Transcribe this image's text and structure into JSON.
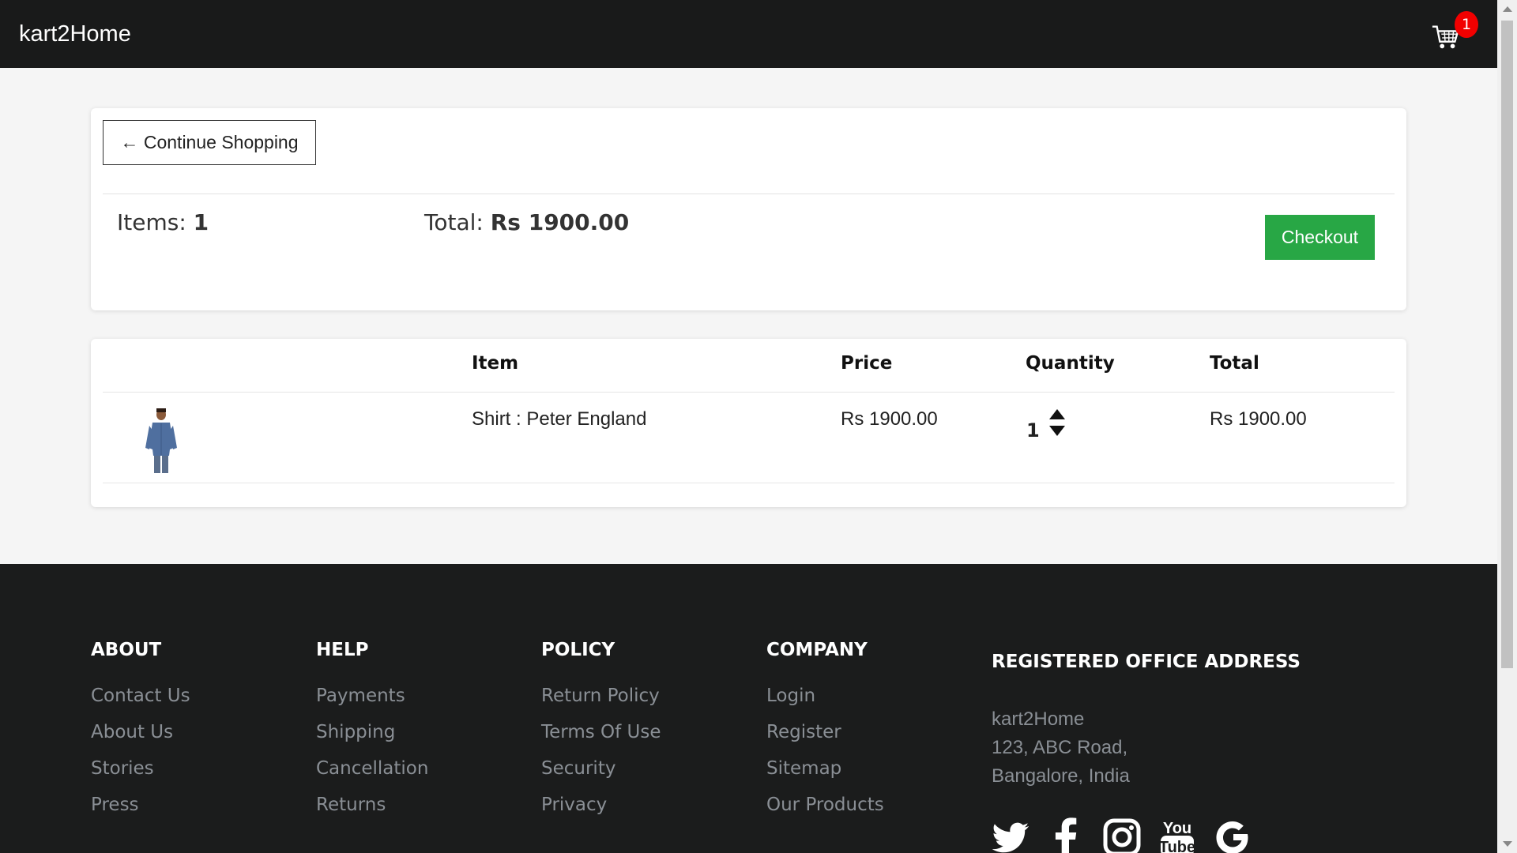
{
  "navbar": {
    "brand": "kart2Home",
    "cart_icon": "shopping-cart-icon",
    "cart_count": "1",
    "badge_color": "#f20000"
  },
  "summary": {
    "continue_label": "← Continue Shopping",
    "items_prefix": "Items:",
    "items_count": "1",
    "total_prefix": "Total:",
    "total_value": "Rs 1900.00",
    "checkout_label": "Checkout",
    "checkout_color": "#28a745"
  },
  "table": {
    "headers": [
      "Item",
      "Price",
      "Quantity",
      "Total"
    ],
    "rows": [
      {
        "thumbnail_icon": "shirt-product-image",
        "item": "Shirt : Peter England",
        "price": "Rs 1900.00",
        "quantity": "1",
        "total": "Rs 1900.00"
      }
    ]
  },
  "footer": {
    "columns": [
      {
        "heading": "ABOUT",
        "links": [
          "Contact Us",
          "About Us",
          "Stories",
          "Press"
        ]
      },
      {
        "heading": "HELP",
        "links": [
          "Payments",
          "Shipping",
          "Cancellation",
          "Returns"
        ]
      },
      {
        "heading": "POLICY",
        "links": [
          "Return Policy",
          "Terms Of Use",
          "Security",
          "Privacy"
        ]
      },
      {
        "heading": "COMPANY",
        "links": [
          "Login",
          "Register",
          "Sitemap",
          "Our Products"
        ]
      }
    ],
    "address": {
      "heading": "REGISTERED OFFICE ADDRESS",
      "lines": [
        "kart2Home",
        "123, ABC Road,",
        "Bangalore, India"
      ]
    },
    "social_icons": [
      "twitter-icon",
      "facebook-icon",
      "instagram-icon",
      "youtube-icon",
      "google-icon"
    ]
  }
}
